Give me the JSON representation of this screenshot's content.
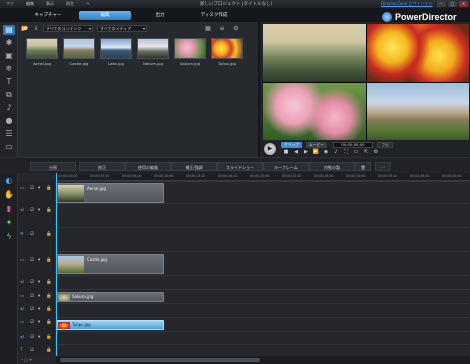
{
  "window": {
    "menu": [
      "ファ",
      "編集",
      "表示",
      "再生",
      "ヘ"
    ],
    "title": "新しいプロジェクト (タイトルなし)",
    "promo_link": "DirectorZone にサインイン"
  },
  "mode_tabs": [
    "キャプチャー",
    "編集",
    "出力",
    "ディスク作成"
  ],
  "brand": "PowerDirector",
  "library": {
    "filter_content": "すべてのコンテンツ",
    "filter_media": "すべてのメディア",
    "thumbs": [
      "Aerial.jpg",
      "Castle.jpg",
      "Lake.jpg",
      "Nature.jpg",
      "Sakura.jpg",
      "Tulips.jpg"
    ]
  },
  "preview": {
    "mode_clip": "クリップ",
    "mode_movie": "ムービー",
    "timecode": "00;00;00;00",
    "quality": "フル"
  },
  "edit_toolbar": [
    "分割",
    "修正",
    "使用の編集",
    "補正/強調",
    "スライドショー",
    "キーフレーム",
    "何態の製"
  ],
  "timeline": {
    "ruler_ticks": [
      "00;00;00;00",
      "00;00;03;10",
      "00;00;06;20",
      "00;00;10;00",
      "00;00;13;10",
      "00;00;16;20",
      "00;00;20;00",
      "00;00;23;10",
      "00;00;26;20",
      "00;00;30;00",
      "00;00;33;10",
      "00;00;36;20",
      "00;00;40;00"
    ],
    "clips": [
      "Aerial.jpg",
      "Castle.jpg",
      "Sakura.jpg",
      "Tulips.jpg"
    ]
  },
  "colors": {
    "accent": "#3a8ad6",
    "selected_clip": "#6bb8ee"
  }
}
